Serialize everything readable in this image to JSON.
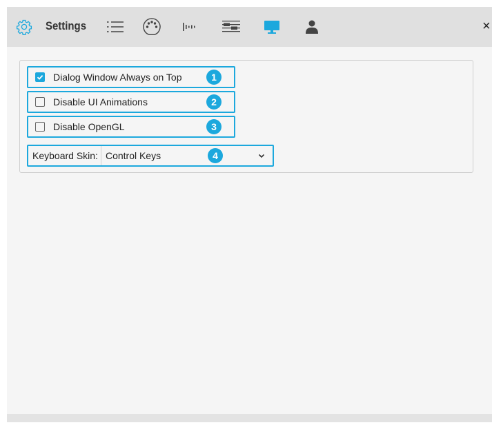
{
  "toolbar": {
    "title": "Settings",
    "accent": "#1ca8dd",
    "icons": [
      "gear-icon",
      "list-icon",
      "midi-port-icon",
      "levels-icon",
      "sliders-icon",
      "monitor-icon",
      "user-icon"
    ],
    "active_icon": "monitor-icon",
    "close_symbol": "×"
  },
  "settings": {
    "dialog_on_top": {
      "label": "Dialog Window Always on Top",
      "checked": true,
      "badge": "1"
    },
    "disable_animations": {
      "label": "Disable UI Animations",
      "checked": false,
      "badge": "2"
    },
    "disable_opengl": {
      "label": "Disable OpenGL",
      "checked": false,
      "badge": "3"
    },
    "keyboard_skin": {
      "label": "Keyboard Skin:",
      "value": "Control Keys",
      "badge": "4"
    }
  }
}
